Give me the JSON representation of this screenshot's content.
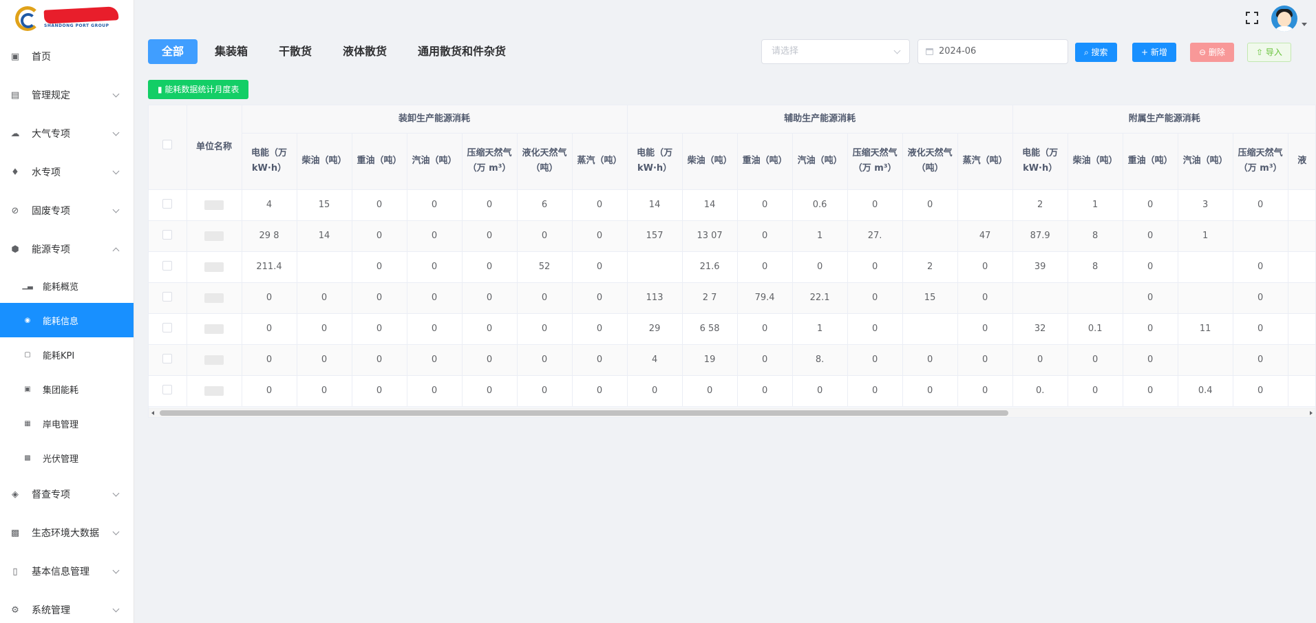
{
  "brand": {
    "logo_sub": "SHANDONG PORT GROUP"
  },
  "sidebar": {
    "items": [
      {
        "label": "首页",
        "icon": "monitor-icon",
        "caret": false
      },
      {
        "label": "管理规定",
        "icon": "archive-icon",
        "caret": true
      },
      {
        "label": "大气专项",
        "icon": "cloud-icon",
        "caret": true
      },
      {
        "label": "水专项",
        "icon": "water-drop-icon",
        "caret": true
      },
      {
        "label": "固废专项",
        "icon": "ban-icon",
        "caret": true
      },
      {
        "label": "能源专项",
        "icon": "energy-icon",
        "caret": true,
        "expanded": true
      }
    ],
    "sub_items": [
      {
        "label": "能耗概览",
        "icon": "bar-chart-icon"
      },
      {
        "label": "能耗信息",
        "icon": "eye-icon",
        "active": true
      },
      {
        "label": "能耗KPI",
        "icon": "kpi-icon"
      },
      {
        "label": "集团能耗",
        "icon": "id-card-icon"
      },
      {
        "label": "岸电管理",
        "icon": "shop-icon"
      },
      {
        "label": "光伏管理",
        "icon": "solar-panel-icon"
      }
    ],
    "items_after": [
      {
        "label": "督查专项",
        "icon": "inspect-icon",
        "caret": true
      },
      {
        "label": "生态环境大数据",
        "icon": "dashboard-icon",
        "caret": true
      },
      {
        "label": "基本信息管理",
        "icon": "book-icon",
        "caret": true
      },
      {
        "label": "系统管理",
        "icon": "gear-icon",
        "caret": true
      }
    ]
  },
  "tabs": [
    "全部",
    "集装箱",
    "干散货",
    "液体散货",
    "通用散货和件杂货"
  ],
  "filters": {
    "select_placeholder": "请选择",
    "date_value": "2024-06"
  },
  "buttons": {
    "search": "搜索",
    "add": "新增",
    "delete": "删除",
    "import": "导入",
    "stat": "能耗数据统计月度表"
  },
  "table": {
    "unit_header": "单位名称",
    "groups": [
      "装卸生产能源消耗",
      "辅助生产能源消耗",
      "附属生产能源消耗"
    ],
    "columns": [
      "电能（万 kW·h）",
      "柴油（吨）",
      "重油（吨）",
      "汽油（吨）",
      "压缩天然气（万 m³）",
      "液化天然气（吨）",
      "蒸汽（吨）"
    ],
    "extra_col_label": "液",
    "rows": [
      [
        "",
        "4",
        "15",
        "0",
        "0",
        "0",
        "6",
        "0",
        "14",
        "14",
        "0",
        "0.6",
        "0",
        "0",
        "",
        "2",
        "1",
        "0",
        "3",
        "0"
      ],
      [
        "",
        "29  8",
        "14",
        "0",
        "0",
        "0",
        "0",
        "0",
        "157",
        "13  07",
        "0",
        "1",
        "27.",
        "",
        "47",
        "87.9",
        "8",
        "0",
        "1",
        ""
      ],
      [
        "",
        "211.4",
        "",
        "0",
        "0",
        "0",
        "52",
        "0",
        "",
        "21.6",
        "0",
        "0",
        "0",
        "2",
        "0",
        "39",
        "8",
        "0",
        "",
        "0"
      ],
      [
        "",
        "0",
        "0",
        "0",
        "0",
        "0",
        "0",
        "0",
        "113",
        "2  7",
        "79.4",
        "22.1",
        "0",
        "15",
        "0",
        "",
        "",
        "0",
        "",
        "0"
      ],
      [
        "",
        "0",
        "0",
        "0",
        "0",
        "0",
        "0",
        "0",
        "29",
        "6  58",
        "0",
        "1",
        "0",
        "",
        "0",
        "32",
        "0.1",
        "0",
        "11",
        "0"
      ],
      [
        "",
        "0",
        "0",
        "0",
        "0",
        "0",
        "0",
        "0",
        "4",
        "19",
        "0",
        "8.",
        "0",
        "0",
        "0",
        "0",
        "0",
        "0",
        "",
        "0"
      ],
      [
        "",
        "0",
        "0",
        "0",
        "0",
        "0",
        "0",
        "0",
        "0",
        "0",
        "0",
        "0",
        "0",
        "0",
        "0",
        "0.",
        "0",
        "0",
        "0.4",
        "0"
      ]
    ]
  }
}
